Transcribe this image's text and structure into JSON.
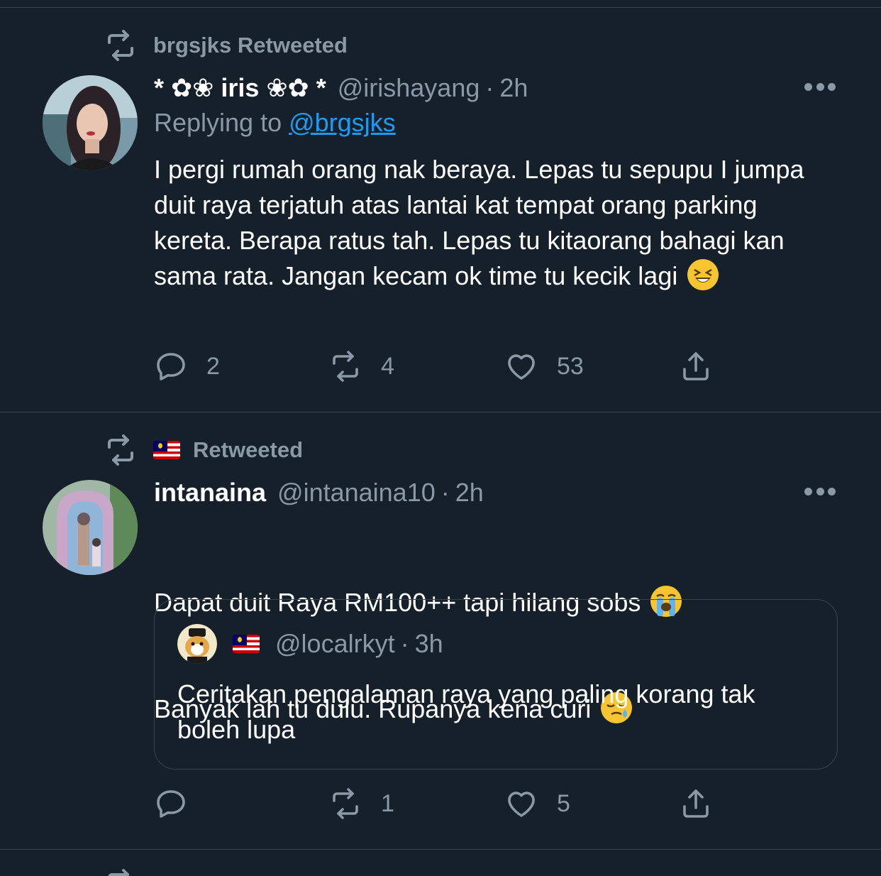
{
  "tweets": [
    {
      "retweeted_by": "brgsjks Retweeted",
      "name": "* ✿❀ iris ❀✿ *",
      "handle": "@irishayang",
      "dot": "·",
      "time": "2h",
      "replying_prefix": "Replying to ",
      "replying_handle": "@brgsjks",
      "text": "I pergi rumah orang nak beraya. Lepas tu sepupu I jumpa duit raya terjatuh atas lantai kat tempat orang parking kereta. Berapa ratus tah. Lepas tu kitaorang bahagi kan sama rata. Jangan kecam ok time tu kecik lagi",
      "emoji": "laughing-squint-face",
      "replies": "2",
      "retweets": "4",
      "likes": "53"
    },
    {
      "retweeted_by": "Retweeted",
      "retweeted_flag": "malaysia-flag",
      "name": "intanaina",
      "handle": "@intanaina10",
      "dot": "·",
      "time": "2h",
      "text_line1": "Dapat duit Raya RM100++ tapi hilang sobs",
      "text_line2": "Banyak lah tu dulu. Rupanya kena curi",
      "emoji1": "loudly-crying-face",
      "emoji2": "sleepy-face",
      "quote": {
        "handle": "@localrkyt",
        "dot": "·",
        "time": "3h",
        "text": "Ceritakan pengalaman raya yang paling korang tak boleh lupa"
      },
      "replies": "",
      "retweets": "1",
      "likes": "5"
    }
  ],
  "colors": {
    "background": "#15202b",
    "secondary_text": "#8b98a5",
    "link": "#1d9bf0",
    "divider": "#38444d"
  }
}
